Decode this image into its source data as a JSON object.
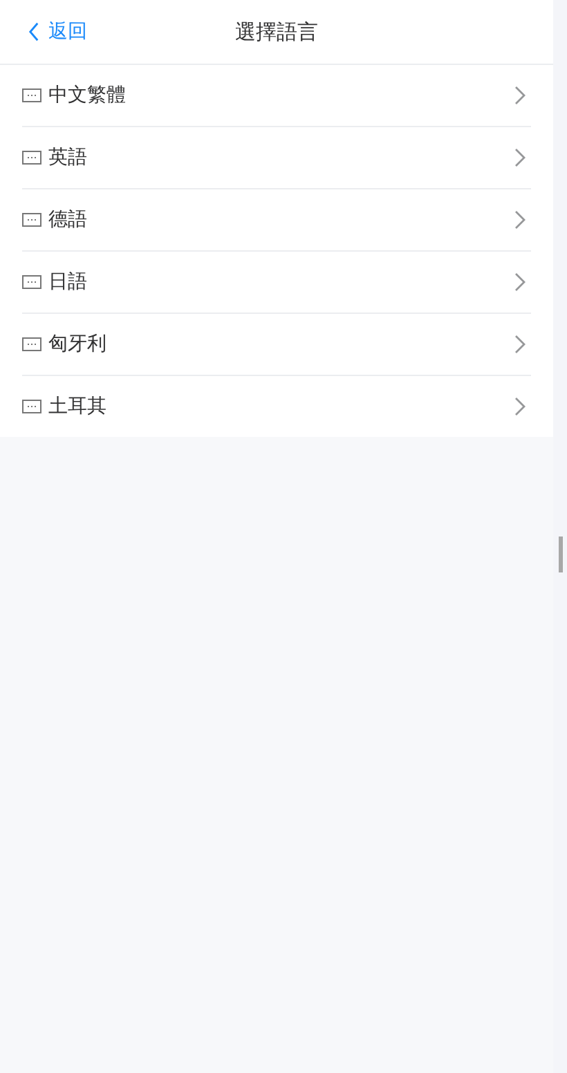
{
  "nav_bar": {
    "back_label": "返回",
    "title": "選擇語言"
  },
  "languages": [
    {
      "label": "中文繁體"
    },
    {
      "label": "英語"
    },
    {
      "label": "德語"
    },
    {
      "label": "日語"
    },
    {
      "label": "匈牙利"
    },
    {
      "label": "土耳其"
    }
  ]
}
